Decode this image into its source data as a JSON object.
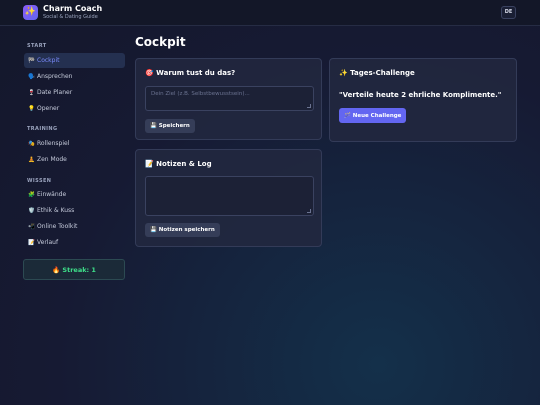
{
  "app": {
    "logo_icon": "✨",
    "title": "Charm Coach",
    "subtitle": "Social & Dating Guide",
    "language": "DE"
  },
  "sidebar": {
    "sections": [
      {
        "label": "START",
        "items": [
          {
            "icon": "🏁",
            "label": "Cockpit",
            "active": true
          },
          {
            "icon": "🗣️",
            "label": "Ansprechen"
          },
          {
            "icon": "🍷",
            "label": "Date Planer"
          },
          {
            "icon": "💡",
            "label": "Opener"
          }
        ]
      },
      {
        "label": "TRAINING",
        "items": [
          {
            "icon": "🎭",
            "label": "Rollenspiel"
          },
          {
            "icon": "🧘",
            "label": "Zen Mode"
          }
        ]
      },
      {
        "label": "WISSEN",
        "items": [
          {
            "icon": "🧩",
            "label": "Einwände"
          },
          {
            "icon": "🛡️",
            "label": "Ethik & Kuss"
          },
          {
            "icon": "📲",
            "label": "Online Toolkit"
          },
          {
            "icon": "📝",
            "label": "Verlauf"
          }
        ]
      }
    ],
    "streak": "🔥 Streak: 1"
  },
  "main": {
    "title": "Cockpit",
    "why_card": {
      "title": "🎯 Warum tust du das?",
      "placeholder": "Dein Ziel (z.B. Selbstbewusstsein)...",
      "save_label": "💾 Speichern"
    },
    "notes_card": {
      "title": "📝 Notizen & Log",
      "placeholder": "",
      "save_label": "💾 Notizen speichern"
    },
    "challenge_card": {
      "title": "✨ Tages-Challenge",
      "text": "\"Verteile heute 2 ehrliche Komplimente.\"",
      "button_label": "🪄 Neue Challenge"
    }
  },
  "colors": {
    "accent": "#6366f1",
    "active_nav": "#7c8cff",
    "streak": "#3ee08a"
  }
}
